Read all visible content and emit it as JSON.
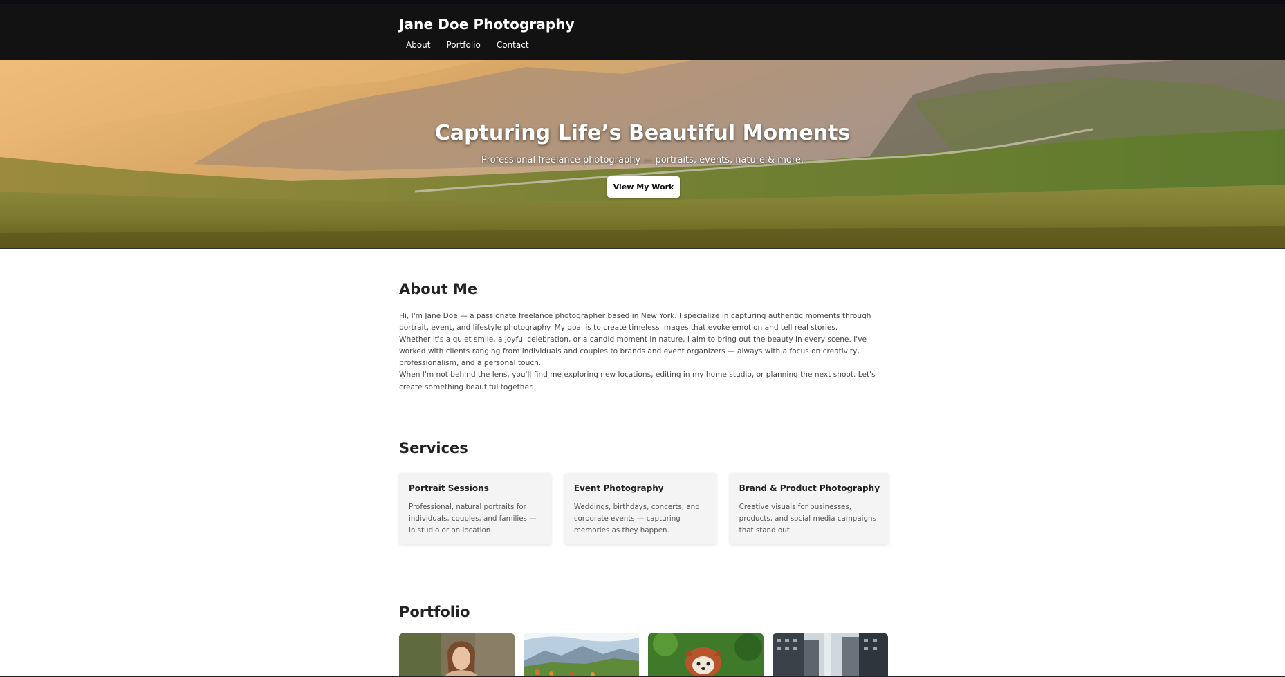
{
  "header": {
    "site_title": "Jane Doe Photography",
    "nav": [
      {
        "label": "About"
      },
      {
        "label": "Portfolio"
      },
      {
        "label": "Contact"
      }
    ]
  },
  "hero": {
    "title": "Capturing Life’s Beautiful Moments",
    "subtitle": "Professional freelance photography — portraits, events, nature & more.",
    "button_label": "View My Work"
  },
  "about": {
    "heading": "About Me",
    "paragraphs": [
      "Hi, I'm Jane Doe — a passionate freelance photographer based in New York. I specialize in capturing authentic moments through portrait, event, and lifestyle photography. My goal is to create timeless images that evoke emotion and tell real stories.",
      "Whether it's a quiet smile, a joyful celebration, or a candid moment in nature, I aim to bring out the beauty in every scene. I've worked with clients ranging from individuals and couples to brands and event organizers — always with a focus on creativity, professionalism, and a personal touch.",
      "When I'm not behind the lens, you'll find me exploring new locations, editing in my home studio, or planning the next shoot. Let's create something beautiful together."
    ]
  },
  "services": {
    "heading": "Services",
    "cards": [
      {
        "title": "Portrait Sessions",
        "description": "Professional, natural portraits for individuals, couples, and families — in studio or on location."
      },
      {
        "title": "Event Photography",
        "description": "Weddings, birthdays, concerts, and corporate events — capturing memories as they happen."
      },
      {
        "title": "Brand & Product Photography",
        "description": "Creative visuals for businesses, products, and social media campaigns that stand out."
      }
    ]
  },
  "portfolio": {
    "heading": "Portfolio",
    "items": [
      {
        "icon": "portrait-photo"
      },
      {
        "icon": "mountain-landscape-photo"
      },
      {
        "icon": "red-panda-photo"
      },
      {
        "icon": "city-street-photo"
      }
    ]
  },
  "colors": {
    "header_bg": "#121212",
    "hero_sky": "#e8b15c",
    "hero_grass": "#6b7a2c",
    "card_bg": "#f4f4f4"
  }
}
